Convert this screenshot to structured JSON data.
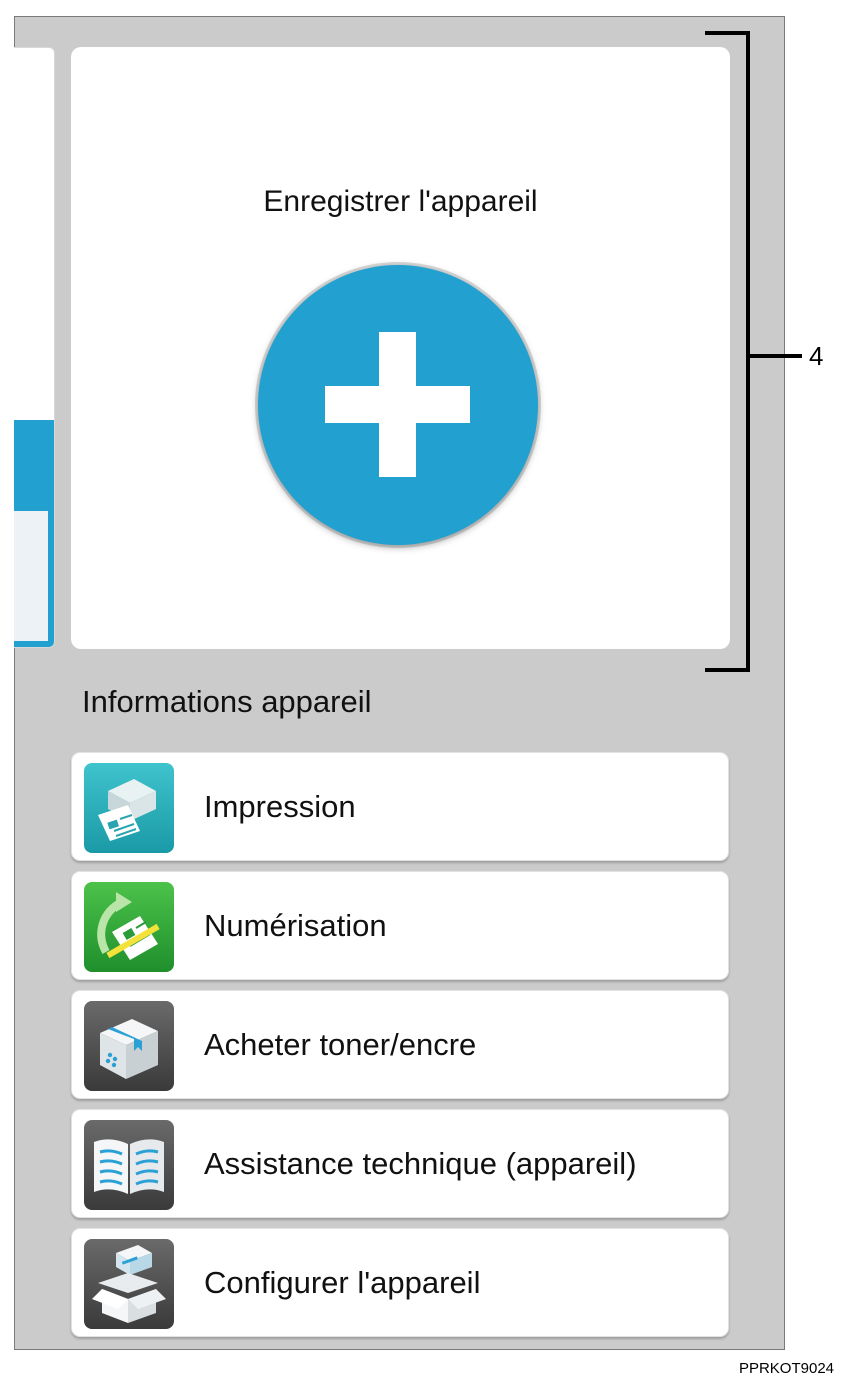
{
  "register": {
    "title": "Enregistrer l'appareil",
    "button_icon": "plus-icon"
  },
  "callout": {
    "number": "4"
  },
  "device_info": {
    "title": "Informations appareil",
    "items": [
      {
        "label": "Impression",
        "icon": "printer-icon"
      },
      {
        "label": "Numérisation",
        "icon": "scan-icon"
      },
      {
        "label": "Acheter toner/encre",
        "icon": "toner-box-icon"
      },
      {
        "label": "Assistance technique (appareil)",
        "icon": "manual-book-icon"
      },
      {
        "label": "Configurer l'appareil",
        "icon": "setup-box-icon"
      }
    ]
  },
  "figure_id": "PPRKOT9024",
  "colors": {
    "accent": "#22a0cf",
    "background": "#cbcbcb",
    "card": "#ffffff"
  }
}
